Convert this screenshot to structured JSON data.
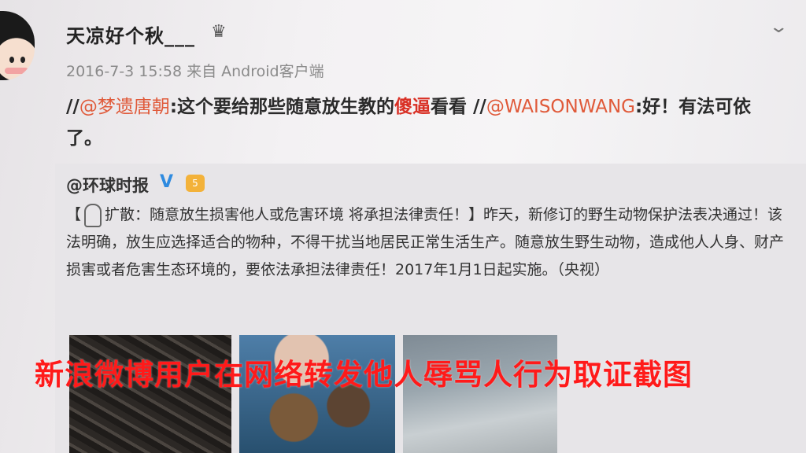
{
  "post": {
    "username": "天凉好个秋___",
    "crown_icon": "crown-icon",
    "timestamp": "2016-7-3 15:58",
    "source": "来自 Android客户端",
    "repost_segments": {
      "s1": "//",
      "m1": "@梦遗唐朝",
      "s2": ":这个要给那些随意放生教的",
      "hl": "傻逼",
      "s3": "看看 //",
      "m2": "@WAISONWANG",
      "s4": ":好！有法可依了。"
    }
  },
  "original": {
    "author": "@环球时报",
    "verified_badge": "V",
    "level_badge": "5",
    "text_a": "【",
    "text_b": "扩散：随意放生损害他人或危害环境 将承担法律责任！】昨天，新修订的野生动物保护法表决通过！该法明确，放生应选择适合的物种，不得干扰当地居民正常生活生产。随意放生野生动物，造成他人人身、财产损害或者危害生态环境的，要依法承担法律责任！2017年1月1日起实施。（央视）"
  },
  "overlay_caption": "新浪微博用户在网络转发他人辱骂人行为取证截图",
  "colors": {
    "mention": "#e05a3a",
    "caption": "#ff1a1a",
    "verified": "#2f8be0"
  }
}
